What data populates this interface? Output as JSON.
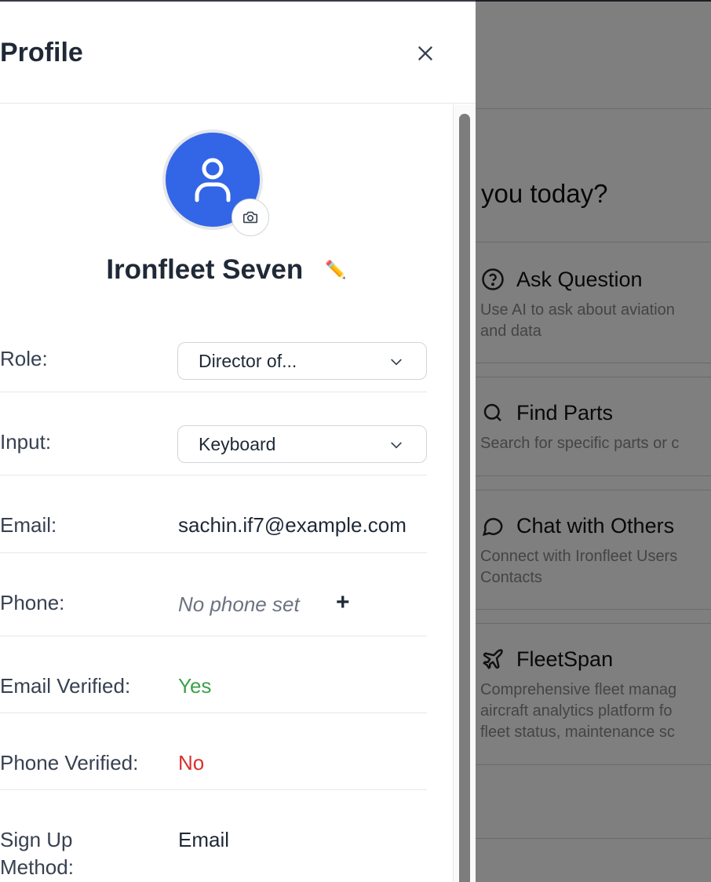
{
  "background": {
    "greeting": "you today?",
    "cards": [
      {
        "icon": "question-circle-icon",
        "title": "Ask Question",
        "description": "Use AI to ask about aviation\nand data"
      },
      {
        "icon": "search-icon",
        "title": "Find Parts",
        "description": "Search for specific parts or c"
      },
      {
        "icon": "chat-bubble-icon",
        "title": "Chat with Others",
        "description": "Connect with Ironfleet Users\nContacts"
      },
      {
        "icon": "airplane-icon",
        "title": "FleetSpan",
        "description": "Comprehensive fleet manag\naircraft analytics platform fo\nfleet status, maintenance sc"
      }
    ]
  },
  "profile": {
    "title": "Profile",
    "name": "Ironfleet Seven",
    "edit_icon": "✏️",
    "fields": {
      "role": {
        "label": "Role:",
        "value": "Director of..."
      },
      "input": {
        "label": "Input:",
        "value": "Keyboard"
      },
      "email": {
        "label": "Email:",
        "value": "sachin.if7@example.com"
      },
      "phone": {
        "label": "Phone:",
        "value": "No phone set",
        "add": "+"
      },
      "email_verified": {
        "label": "Email Verified:",
        "value": "Yes"
      },
      "phone_verified": {
        "label": "Phone Verified:",
        "value": "No"
      },
      "signup_method": {
        "label": "Sign Up\nMethod:",
        "value": "Email"
      }
    }
  },
  "colors": {
    "avatar": "#3366e6",
    "verified_yes": "#3ea14b",
    "verified_no": "#d9302c"
  }
}
